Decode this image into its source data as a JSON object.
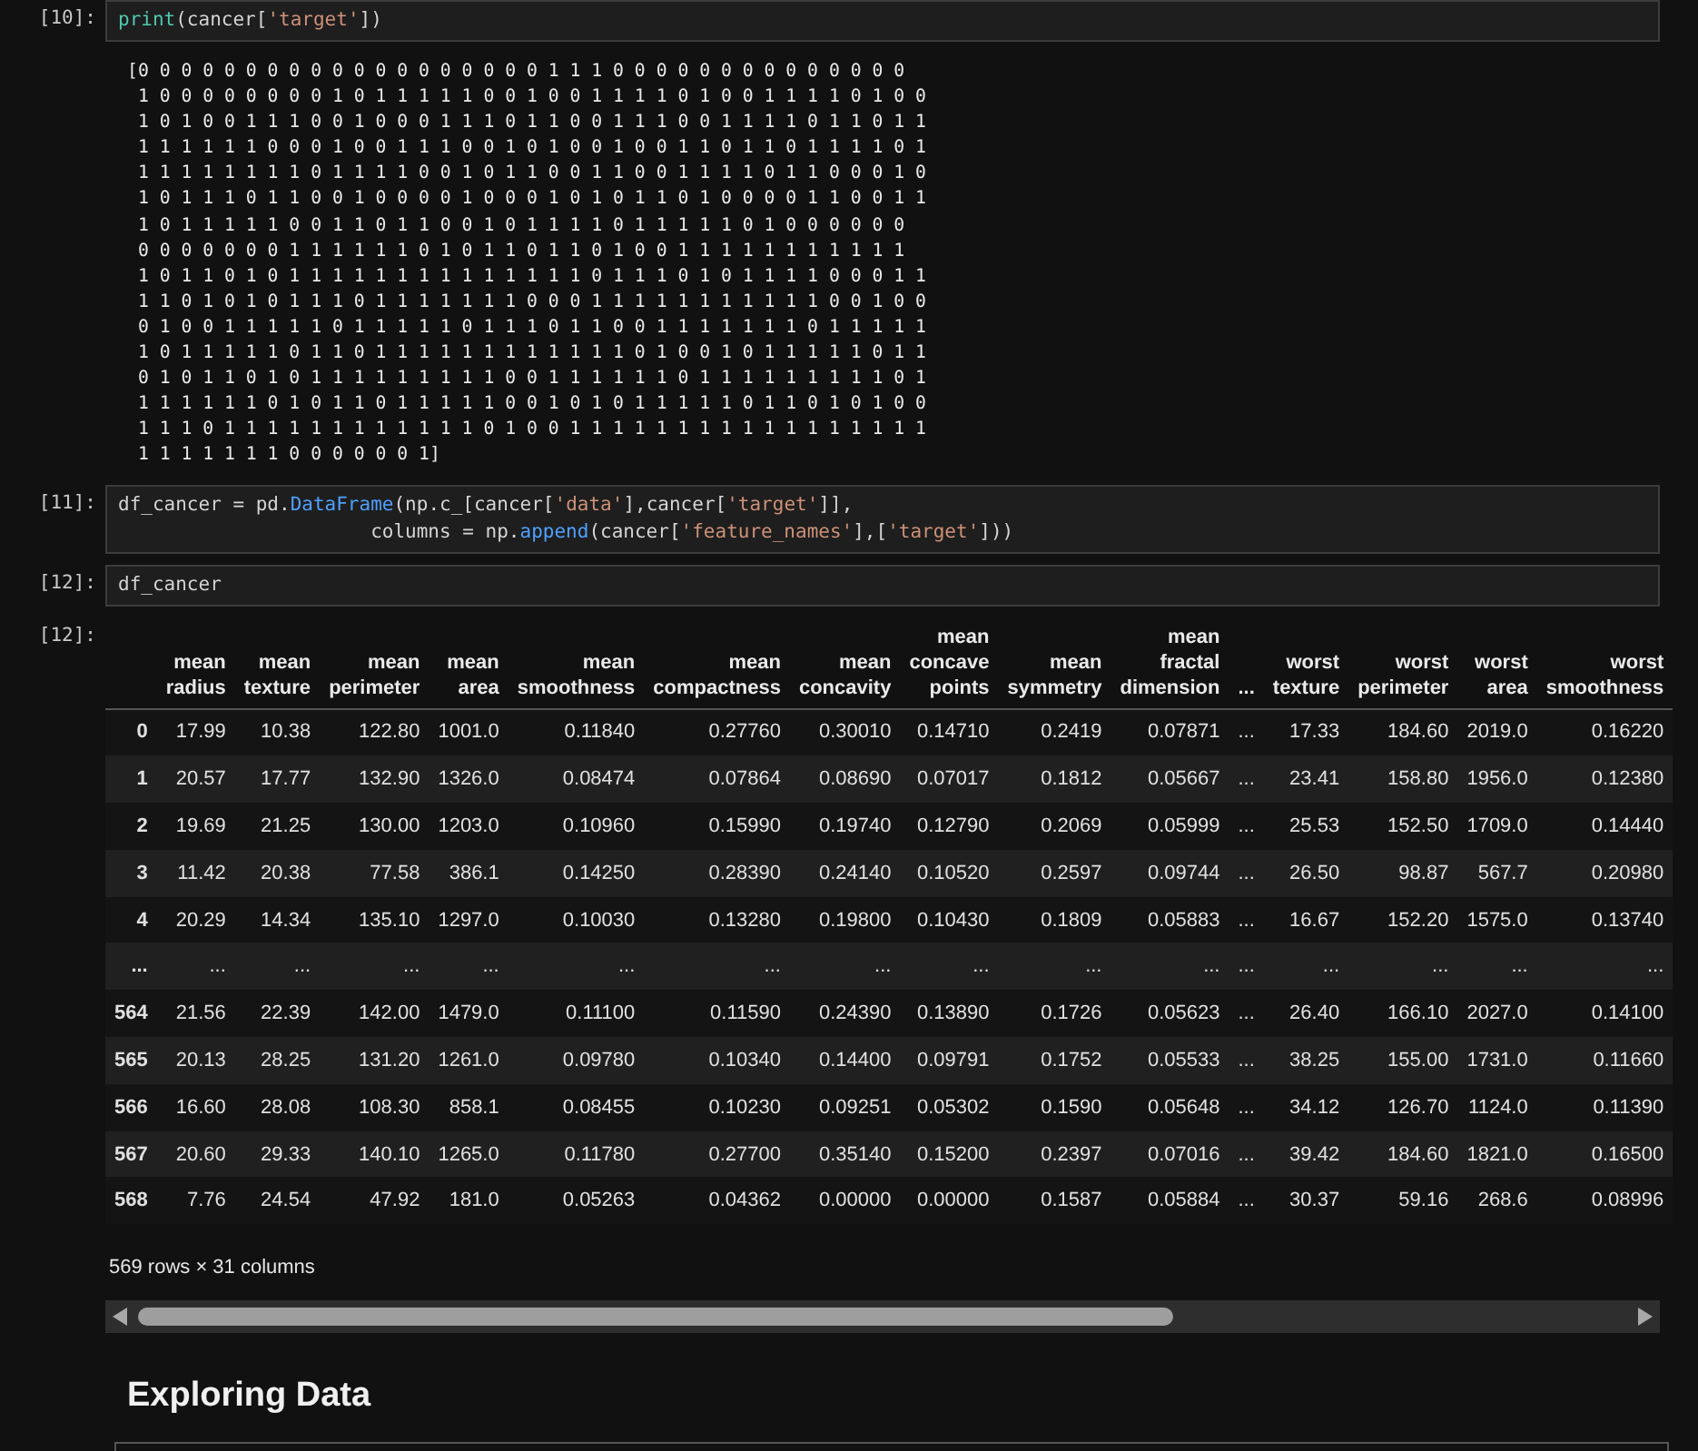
{
  "cells": [
    {
      "kind": "code",
      "prompt": "[10]:",
      "lines": [
        [
          {
            "kind": "builtin",
            "text": "print"
          },
          {
            "kind": "plain",
            "text": "(cancer["
          },
          {
            "kind": "string",
            "text": "'target'"
          },
          {
            "kind": "plain",
            "text": "])"
          }
        ]
      ]
    },
    {
      "kind": "stream",
      "text": "[0 0 0 0 0 0 0 0 0 0 0 0 0 0 0 0 0 0 0 1 1 1 0 0 0 0 0 0 0 0 0 0 0 0 0 0\n 1 0 0 0 0 0 0 0 0 1 0 1 1 1 1 1 0 0 1 0 0 1 1 1 1 0 1 0 0 1 1 1 1 0 1 0 0\n 1 0 1 0 0 1 1 1 0 0 1 0 0 0 1 1 1 0 1 1 0 0 1 1 1 0 0 1 1 1 1 0 1 1 0 1 1\n 1 1 1 1 1 1 0 0 0 1 0 0 1 1 1 0 0 1 0 1 0 0 1 0 0 1 1 0 1 1 0 1 1 1 1 0 1\n 1 1 1 1 1 1 1 1 0 1 1 1 1 0 0 1 0 1 1 0 0 1 1 0 0 1 1 1 1 0 1 1 0 0 0 1 0\n 1 0 1 1 1 0 1 1 0 0 1 0 0 0 0 1 0 0 0 1 0 1 0 1 1 0 1 0 0 0 0 1 1 0 0 1 1\n 1 0 1 1 1 1 1 0 0 1 1 0 1 1 0 0 1 0 1 1 1 1 0 1 1 1 1 1 0 1 0 0 0 0 0 0\n 0 0 0 0 0 0 0 1 1 1 1 1 1 0 1 0 1 1 0 1 1 0 1 0 0 1 1 1 1 1 1 1 1 1 1 1\n 1 0 1 1 0 1 0 1 1 1 1 1 1 1 1 1 1 1 1 1 1 0 1 1 1 0 1 0 1 1 1 1 0 0 0 1 1\n 1 1 0 1 0 1 0 1 1 1 0 1 1 1 1 1 1 1 0 0 0 1 1 1 1 1 1 1 1 1 1 1 0 0 1 0 0\n 0 1 0 0 1 1 1 1 1 0 1 1 1 1 1 0 1 1 1 0 1 1 0 0 1 1 1 1 1 1 1 0 1 1 1 1 1\n 1 0 1 1 1 1 1 0 1 1 0 1 1 1 1 1 1 1 1 1 1 1 1 0 1 0 0 1 0 1 1 1 1 1 0 1 1\n 0 1 0 1 1 0 1 0 1 1 1 1 1 1 1 1 1 0 0 1 1 1 1 1 1 0 1 1 1 1 1 1 1 1 1 0 1\n 1 1 1 1 1 1 0 1 0 1 1 0 1 1 1 1 1 0 0 1 0 1 0 1 1 1 1 1 0 1 1 0 1 0 1 0 0\n 1 1 1 0 1 1 1 1 1 1 1 1 1 1 1 1 0 1 0 0 1 1 1 1 1 1 1 1 1 1 1 1 1 1 1 1 1\n 1 1 1 1 1 1 1 0 0 0 0 0 0 1]"
    },
    {
      "kind": "code",
      "prompt": "[11]:",
      "lines": [
        [
          {
            "kind": "plain",
            "text": "df_cancer = pd."
          },
          {
            "kind": "attr",
            "text": "DataFrame"
          },
          {
            "kind": "plain",
            "text": "(np.c_[cancer["
          },
          {
            "kind": "string",
            "text": "'data'"
          },
          {
            "kind": "plain",
            "text": "],cancer["
          },
          {
            "kind": "string",
            "text": "'target'"
          },
          {
            "kind": "plain",
            "text": "]],"
          }
        ],
        [
          {
            "kind": "plain",
            "text": "                      columns = np."
          },
          {
            "kind": "attr",
            "text": "append"
          },
          {
            "kind": "plain",
            "text": "(cancer["
          },
          {
            "kind": "string",
            "text": "'feature_names'"
          },
          {
            "kind": "plain",
            "text": "],["
          },
          {
            "kind": "string",
            "text": "'target'"
          },
          {
            "kind": "plain",
            "text": "]))"
          }
        ]
      ]
    },
    {
      "kind": "code",
      "prompt": "[12]:",
      "lines": [
        [
          {
            "kind": "plain",
            "text": "df_cancer"
          }
        ]
      ]
    },
    {
      "kind": "table",
      "prompt": "[12]:",
      "columns": [
        "mean radius",
        "mean texture",
        "mean perimeter",
        "mean area",
        "mean smoothness",
        "mean compactness",
        "mean concavity",
        "mean concave points",
        "mean symmetry",
        "mean fractal dimension",
        "...",
        "worst texture",
        "worst perimeter",
        "worst area",
        "worst smoothness"
      ],
      "rows": [
        {
          "index": "0",
          "cells": [
            "17.99",
            "10.38",
            "122.80",
            "1001.0",
            "0.11840",
            "0.27760",
            "0.30010",
            "0.14710",
            "0.2419",
            "0.07871",
            "...",
            "17.33",
            "184.60",
            "2019.0",
            "0.16220"
          ]
        },
        {
          "index": "1",
          "cells": [
            "20.57",
            "17.77",
            "132.90",
            "1326.0",
            "0.08474",
            "0.07864",
            "0.08690",
            "0.07017",
            "0.1812",
            "0.05667",
            "...",
            "23.41",
            "158.80",
            "1956.0",
            "0.12380"
          ]
        },
        {
          "index": "2",
          "cells": [
            "19.69",
            "21.25",
            "130.00",
            "1203.0",
            "0.10960",
            "0.15990",
            "0.19740",
            "0.12790",
            "0.2069",
            "0.05999",
            "...",
            "25.53",
            "152.50",
            "1709.0",
            "0.14440"
          ]
        },
        {
          "index": "3",
          "cells": [
            "11.42",
            "20.38",
            "77.58",
            "386.1",
            "0.14250",
            "0.28390",
            "0.24140",
            "0.10520",
            "0.2597",
            "0.09744",
            "...",
            "26.50",
            "98.87",
            "567.7",
            "0.20980"
          ]
        },
        {
          "index": "4",
          "cells": [
            "20.29",
            "14.34",
            "135.10",
            "1297.0",
            "0.10030",
            "0.13280",
            "0.19800",
            "0.10430",
            "0.1809",
            "0.05883",
            "...",
            "16.67",
            "152.20",
            "1575.0",
            "0.13740"
          ]
        },
        {
          "index": "...",
          "cells": [
            "...",
            "...",
            "...",
            "...",
            "...",
            "...",
            "...",
            "...",
            "...",
            "...",
            "...",
            "...",
            "...",
            "...",
            "..."
          ]
        },
        {
          "index": "564",
          "cells": [
            "21.56",
            "22.39",
            "142.00",
            "1479.0",
            "0.11100",
            "0.11590",
            "0.24390",
            "0.13890",
            "0.1726",
            "0.05623",
            "...",
            "26.40",
            "166.10",
            "2027.0",
            "0.14100"
          ]
        },
        {
          "index": "565",
          "cells": [
            "20.13",
            "28.25",
            "131.20",
            "1261.0",
            "0.09780",
            "0.10340",
            "0.14400",
            "0.09791",
            "0.1752",
            "0.05533",
            "...",
            "38.25",
            "155.00",
            "1731.0",
            "0.11660"
          ]
        },
        {
          "index": "566",
          "cells": [
            "16.60",
            "28.08",
            "108.30",
            "858.1",
            "0.08455",
            "0.10230",
            "0.09251",
            "0.05302",
            "0.1590",
            "0.05648",
            "...",
            "34.12",
            "126.70",
            "1124.0",
            "0.11390"
          ]
        },
        {
          "index": "567",
          "cells": [
            "20.60",
            "29.33",
            "140.10",
            "1265.0",
            "0.11780",
            "0.27700",
            "0.35140",
            "0.15200",
            "0.2397",
            "0.07016",
            "...",
            "39.42",
            "184.60",
            "1821.0",
            "0.16500"
          ]
        },
        {
          "index": "568",
          "cells": [
            "7.76",
            "24.54",
            "47.92",
            "181.0",
            "0.05263",
            "0.04362",
            "0.00000",
            "0.00000",
            "0.1587",
            "0.05884",
            "...",
            "30.37",
            "59.16",
            "268.6",
            "0.08996"
          ]
        }
      ],
      "footer": "569 rows × 31 columns"
    },
    {
      "kind": "heading",
      "text": "Exploring Data"
    },
    {
      "kind": "empty"
    }
  ]
}
